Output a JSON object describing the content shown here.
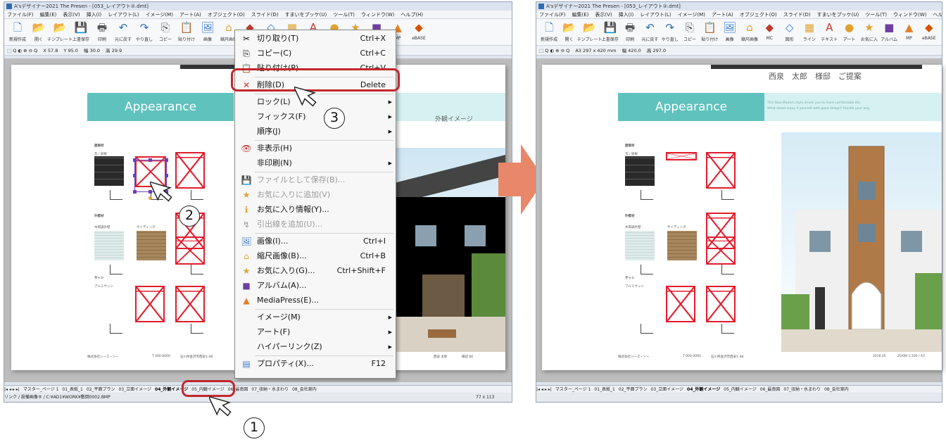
{
  "window": {
    "title": "A'sデザイナー2021 The Presen - [053_レイアウト②.dmt]",
    "menu": [
      "ファイル(F)",
      "編集(E)",
      "表示(V)",
      "挿入(I)",
      "レイアウト(L)",
      "イメージ(M)",
      "アート(A)",
      "オブジェクト(O)",
      "スライド(D)",
      "すまいをプッケ(U)",
      "ツール(T)",
      "ウィンドウ(W)",
      "ヘルプ(H)"
    ]
  },
  "toolbar": {
    "items": [
      {
        "label": "新規作成",
        "icon": "new-document-icon",
        "glyph": "🗋",
        "color": "#4a78c2"
      },
      {
        "label": "開く",
        "icon": "open-folder-icon",
        "glyph": "📂",
        "color": "#e0a22f"
      },
      {
        "label": "テンプレート",
        "icon": "template-icon",
        "glyph": "📂",
        "color": "#3a7bd5"
      },
      {
        "label": "上書保存",
        "icon": "save-icon",
        "glyph": "💾",
        "color": "#2f57a8"
      },
      {
        "label": "印刷",
        "icon": "print-icon",
        "glyph": "🖶",
        "color": "#555555"
      },
      {
        "label": "元に戻す",
        "icon": "undo-icon",
        "glyph": "↶",
        "color": "#2e6db4"
      },
      {
        "label": "やり直し",
        "icon": "redo-icon",
        "glyph": "↷",
        "color": "#2e6db4"
      },
      {
        "label": "コピー",
        "icon": "copy-icon",
        "glyph": "⎘",
        "color": "#555555"
      },
      {
        "label": "貼り付け",
        "icon": "paste-icon",
        "glyph": "📋",
        "color": "#555555"
      },
      {
        "label": "画像",
        "icon": "image-icon",
        "glyph": "🖼",
        "color": "#3a7bd5"
      },
      {
        "label": "縮尺画像",
        "icon": "scaled-image-icon",
        "glyph": "⌂",
        "color": "#e0a22f"
      },
      {
        "label": "MC",
        "icon": "mc-icon",
        "glyph": "◆",
        "color": "#c0392b"
      },
      {
        "label": "図形",
        "icon": "shape-icon",
        "glyph": "◇",
        "color": "#3a7bd5"
      },
      {
        "label": "ライン",
        "icon": "line-icon",
        "glyph": "▦",
        "color": "#e0a22f"
      },
      {
        "label": "テキスト",
        "icon": "text-icon",
        "glyph": "A",
        "color": "#c0392b"
      },
      {
        "label": "アート",
        "icon": "art-icon",
        "glyph": "●",
        "color": "#e0a22f"
      },
      {
        "label": "お気に入",
        "icon": "favorite-star-icon",
        "glyph": "★",
        "color": "#e0a22f"
      },
      {
        "label": "アルバム",
        "icon": "album-icon",
        "glyph": "■",
        "color": "#6f3fa0"
      },
      {
        "label": "MP",
        "icon": "mediapress-icon",
        "glyph": "▲",
        "color": "#e67e22"
      },
      {
        "label": "eBASE",
        "icon": "ebase-icon",
        "glyph": "◆",
        "color": "#d35400"
      }
    ]
  },
  "left": {
    "propbar": [
      "X 57.8",
      "Y 95.0",
      "幅 30.0",
      "高 29.9"
    ],
    "tabs": [
      "マスター_ページ 1",
      "01_表紙_1",
      "02_平面プラン",
      "03_立面イメージ",
      "04_外観イメージ",
      "05_内観イメージ",
      "06_最南図",
      "07_収納・水まわり",
      "08_会社案内"
    ],
    "active_tab": "04_外観イメージ",
    "status": "リンク / 設備画像® / C:¥AD1¥WORK¥敷倒0002.BMP",
    "status_right": "77 x 113"
  },
  "right": {
    "propbar": [
      "A3 297 x 420 mm",
      "幅 420.0",
      "高 297.0"
    ],
    "header_name": "西泉　太郎　様邸　ご提案",
    "tabs": [
      "マスター_ページ 1",
      "01_表紙_1",
      "02_平面プラン",
      "03_立面イメージ",
      "04_外観イメージ",
      "05_内観イメージ",
      "06_最南図",
      "07_収納・水まわり",
      "08_会社案内"
    ],
    "active_tab": "04_外観イメージ"
  },
  "page": {
    "appearance_title": "Appearance",
    "appearance_jp": "外観イメージ",
    "tagline_1": "This New Modern style drives you to more comfortable life.",
    "tagline_2": "What about enjoy it yourself with good design? Handle your way.",
    "label_roof": "屋根材",
    "label_roof_sub": "瓦 / 屋根",
    "label_wall": "外壁材",
    "label_wall_sub_1": "木目調外壁",
    "label_wall_sub_2": "サイディング",
    "label_sash": "サッシ",
    "label_sash_sub": "アルミサッシ",
    "footer_company": "株式会社シーズ・シー",
    "footer_tel": "T 000-0000",
    "footer_address": "石川県金沢市西泉1-48",
    "footer_name_left": "西泉 太郎",
    "footer_date_left": "確認 BE",
    "footer_name_right": "2018.05.",
    "footer_date_right": "ZOOM 1:100 / A3"
  },
  "context_menu": {
    "items": [
      {
        "label": "切り取り(T)",
        "shortcut": "Ctrl+X",
        "icon": "scissors-icon",
        "glyph": "✂",
        "disabled": false,
        "submenu": false
      },
      {
        "label": "コピー(C)",
        "shortcut": "Ctrl+C",
        "icon": "copy-icon",
        "glyph": "⎘",
        "disabled": false,
        "submenu": false
      },
      {
        "label": "貼り付け(P)",
        "shortcut": "Ctrl+V",
        "icon": "paste-icon",
        "glyph": "📋",
        "disabled": false,
        "submenu": false
      },
      {
        "label": "削除(D)",
        "shortcut": "Delete",
        "icon": "delete-x-icon",
        "glyph": "✕",
        "disabled": false,
        "submenu": false
      },
      {
        "label": "ロック(L)",
        "shortcut": "",
        "icon": "",
        "glyph": "",
        "disabled": false,
        "submenu": true
      },
      {
        "label": "フィックス(F)",
        "shortcut": "",
        "icon": "",
        "glyph": "",
        "disabled": false,
        "submenu": true
      },
      {
        "label": "順序(J)",
        "shortcut": "",
        "icon": "",
        "glyph": "",
        "disabled": false,
        "submenu": true
      },
      {
        "label": "非表示(H)",
        "shortcut": "",
        "icon": "hide-eye-icon",
        "glyph": "👁",
        "disabled": false,
        "submenu": false
      },
      {
        "label": "非印刷(N)",
        "shortcut": "",
        "icon": "",
        "glyph": "",
        "disabled": false,
        "submenu": true
      },
      {
        "label": "ファイルとして保存(B)...",
        "shortcut": "",
        "icon": "save-file-icon",
        "glyph": "💾",
        "disabled": true,
        "submenu": false
      },
      {
        "label": "お気に入りに追加(V)",
        "shortcut": "",
        "icon": "add-favorite-icon",
        "glyph": "★",
        "disabled": true,
        "submenu": false
      },
      {
        "label": "お気に入り情報(Y)...",
        "shortcut": "",
        "icon": "favorite-info-icon",
        "glyph": "ℹ",
        "disabled": false,
        "submenu": false
      },
      {
        "label": "引出線を追加(U)...",
        "shortcut": "",
        "icon": "leader-line-icon",
        "glyph": "↯",
        "disabled": true,
        "submenu": false
      },
      {
        "label": "画像(I)...",
        "shortcut": "Ctrl+I",
        "icon": "image-icon",
        "glyph": "🖼",
        "disabled": false,
        "submenu": false
      },
      {
        "label": "縮尺画像(B)...",
        "shortcut": "Ctrl+B",
        "icon": "house-icon",
        "glyph": "⌂",
        "disabled": false,
        "submenu": false
      },
      {
        "label": "お気に入り(G)...",
        "shortcut": "Ctrl+Shift+F",
        "icon": "star-icon",
        "glyph": "★",
        "disabled": false,
        "submenu": false
      },
      {
        "label": "アルバム(A)...",
        "shortcut": "",
        "icon": "album-icon",
        "glyph": "■",
        "disabled": false,
        "submenu": false
      },
      {
        "label": "MediaPress(E)...",
        "shortcut": "",
        "icon": "mediapress-icon",
        "glyph": "▲",
        "disabled": false,
        "submenu": false
      },
      {
        "label": "イメージ(M)",
        "shortcut": "",
        "icon": "",
        "glyph": "",
        "disabled": false,
        "submenu": true
      },
      {
        "label": "アート(F)",
        "shortcut": "",
        "icon": "",
        "glyph": "",
        "disabled": false,
        "submenu": true
      },
      {
        "label": "ハイパーリンク(Z)",
        "shortcut": "",
        "icon": "",
        "glyph": "",
        "disabled": false,
        "submenu": true
      },
      {
        "label": "プロパティ(X)...",
        "shortcut": "F12",
        "icon": "properties-icon",
        "glyph": "▤",
        "disabled": false,
        "submenu": false
      }
    ]
  },
  "steps": [
    "1",
    "2",
    "3"
  ],
  "colors": {
    "highlight": "#c1272d",
    "teal": "#5fc2bd",
    "band": "#d6f1f1",
    "red_box": "#e21d2d",
    "arrow": "#e8876a"
  }
}
